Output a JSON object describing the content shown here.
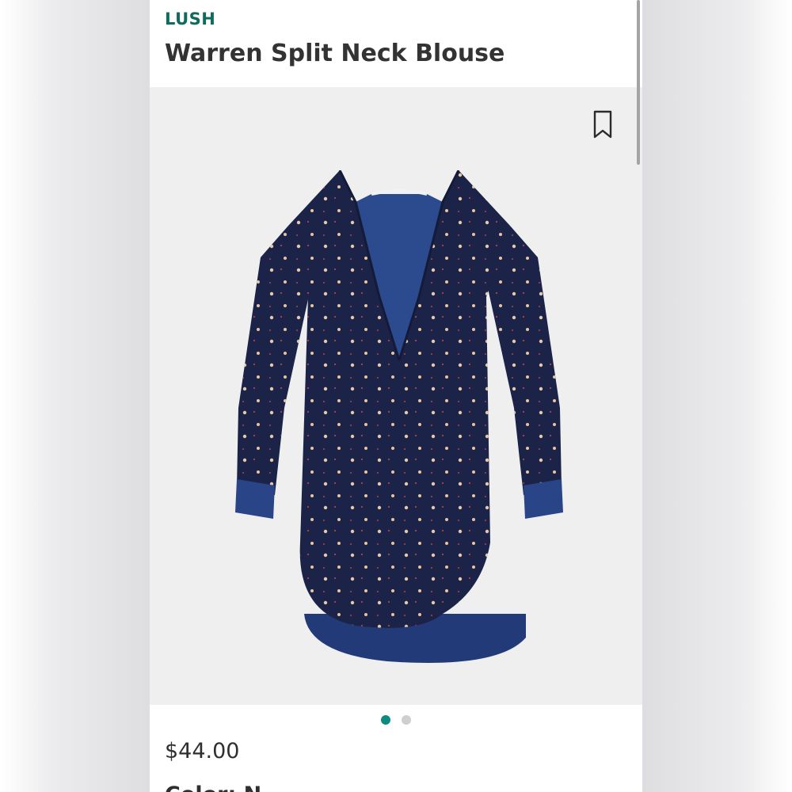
{
  "product": {
    "brand": "LUSH",
    "name": "Warren Split Neck Blouse",
    "price": "$44.00",
    "next_label": "Color: N"
  },
  "carousel": {
    "count": 2,
    "active_index": 0
  },
  "colors": {
    "brand_green": "#0e6b5d",
    "dot_active": "#0e8a80",
    "dot_inactive": "#cfcfcf",
    "blouse_navy": "#1b2448"
  },
  "icons": {
    "bookmark": "bookmark-icon"
  }
}
